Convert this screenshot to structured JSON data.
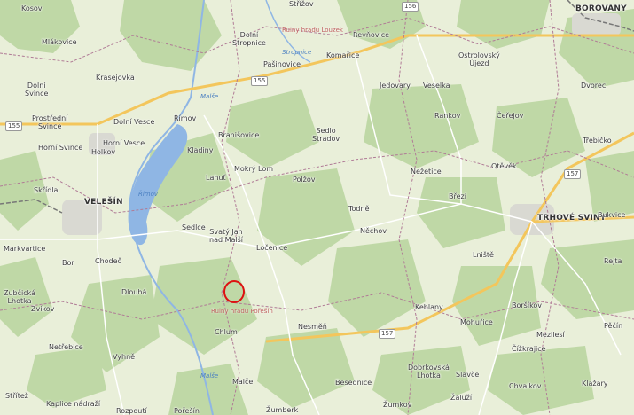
{
  "colors": {
    "forest": "#bfd8a6",
    "field": "#eef1df",
    "water": "#8fb6e4",
    "road_main": "#f6d37a",
    "boundary": "#b07b96",
    "marker": "#dd1111"
  },
  "places": [
    {
      "name": "Kosov",
      "cls": ""
    },
    {
      "name": "Střížov",
      "cls": ""
    },
    {
      "name": "BOROVANY",
      "cls": "big"
    },
    {
      "name": "Mlákovice",
      "cls": ""
    },
    {
      "name": "Dolní\nStropnice",
      "cls": "ctr"
    },
    {
      "name": "Komařice",
      "cls": ""
    },
    {
      "name": "Revňovice",
      "cls": ""
    },
    {
      "name": "Pašinovice",
      "cls": ""
    },
    {
      "name": "Ostrolovský\nÚjezd",
      "cls": "ctr"
    },
    {
      "name": "Krasejovka",
      "cls": ""
    },
    {
      "name": "Dolní\nSvince",
      "cls": "ctr"
    },
    {
      "name": "Jedovary",
      "cls": ""
    },
    {
      "name": "Veselka",
      "cls": ""
    },
    {
      "name": "Dvorec",
      "cls": ""
    },
    {
      "name": "Římov",
      "cls": ""
    },
    {
      "name": "Dolní Vesce",
      "cls": ""
    },
    {
      "name": "Prostřední\nSvince",
      "cls": "ctr"
    },
    {
      "name": "Rankov",
      "cls": ""
    },
    {
      "name": "Čeřejov",
      "cls": ""
    },
    {
      "name": "Sedlo\nStradov",
      "cls": "ctr"
    },
    {
      "name": "Branišovice",
      "cls": ""
    },
    {
      "name": "Horní Vesce",
      "cls": ""
    },
    {
      "name": "Horní Svince",
      "cls": ""
    },
    {
      "name": "Holkov",
      "cls": ""
    },
    {
      "name": "Kladiny",
      "cls": ""
    },
    {
      "name": "Třebíčko",
      "cls": ""
    },
    {
      "name": "Mokrý Lom",
      "cls": ""
    },
    {
      "name": "Otěvěk",
      "cls": ""
    },
    {
      "name": "Nežetice",
      "cls": ""
    },
    {
      "name": "Lahuť",
      "cls": ""
    },
    {
      "name": "Polžov",
      "cls": ""
    },
    {
      "name": "Skřídla",
      "cls": ""
    },
    {
      "name": "VELEŠÍN",
      "cls": "big"
    },
    {
      "name": "Březí",
      "cls": ""
    },
    {
      "name": "Todně",
      "cls": ""
    },
    {
      "name": "TRHOVÉ SVINY",
      "cls": "big"
    },
    {
      "name": "Bukvice",
      "cls": ""
    },
    {
      "name": "Sedlce",
      "cls": ""
    },
    {
      "name": "Svatý Jan\nnad Malší",
      "cls": "ctr"
    },
    {
      "name": "Něchov",
      "cls": ""
    },
    {
      "name": "Markvartice",
      "cls": ""
    },
    {
      "name": "Ločenice",
      "cls": ""
    },
    {
      "name": "Lniště",
      "cls": ""
    },
    {
      "name": "Bor",
      "cls": ""
    },
    {
      "name": "Chodeč",
      "cls": ""
    },
    {
      "name": "Rejta",
      "cls": ""
    },
    {
      "name": "Dlouhá",
      "cls": ""
    },
    {
      "name": "Zubčická\nLhotka",
      "cls": "ctr"
    },
    {
      "name": "Zvíkov",
      "cls": ""
    },
    {
      "name": "Keblany",
      "cls": ""
    },
    {
      "name": "Boršíkov",
      "cls": ""
    },
    {
      "name": "Chlum",
      "cls": ""
    },
    {
      "name": "Nesměň",
      "cls": ""
    },
    {
      "name": "Mohuřice",
      "cls": ""
    },
    {
      "name": "Pěčín",
      "cls": ""
    },
    {
      "name": "Mezilesí",
      "cls": ""
    },
    {
      "name": "Netřebice",
      "cls": ""
    },
    {
      "name": "Čížkrajice",
      "cls": ""
    },
    {
      "name": "Vyhně",
      "cls": ""
    },
    {
      "name": "Dobrkovská\nLhotka",
      "cls": "ctr"
    },
    {
      "name": "Slavče",
      "cls": ""
    },
    {
      "name": "Střítež",
      "cls": ""
    },
    {
      "name": "Malče",
      "cls": ""
    },
    {
      "name": "Besednice",
      "cls": ""
    },
    {
      "name": "Chvalkov",
      "cls": ""
    },
    {
      "name": "Klažary",
      "cls": ""
    },
    {
      "name": "Kaplice nádraží",
      "cls": ""
    },
    {
      "name": "Rozpoutí",
      "cls": ""
    },
    {
      "name": "Pořešín",
      "cls": ""
    },
    {
      "name": "Žumberk",
      "cls": ""
    },
    {
      "name": "Žaluží",
      "cls": ""
    },
    {
      "name": "Žumkov",
      "cls": ""
    }
  ],
  "roads": [
    "156",
    "155",
    "155",
    "157",
    "157"
  ],
  "water_labels": [
    "Malše",
    "Římov",
    "Stropnice",
    "Malše"
  ],
  "poi_labels": [
    "Ruiny hradu Pořešín",
    "Ruiny hradu Louzek"
  ]
}
